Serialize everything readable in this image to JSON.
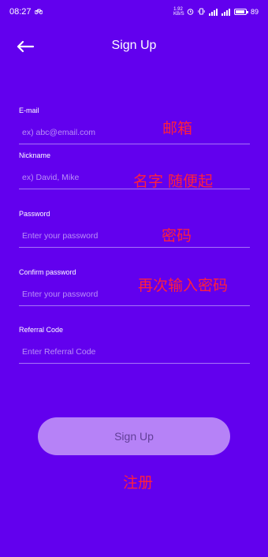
{
  "status_bar": {
    "time": "08:27",
    "speed": "1.92 KB/S",
    "battery": "89",
    "network": "4G"
  },
  "app_bar": {
    "back_icon": "arrow-left-icon",
    "title": "Sign Up"
  },
  "form": {
    "email": {
      "label": "E-mail",
      "placeholder": "ex) abc@email.com"
    },
    "nickname": {
      "label": "Nickname",
      "placeholder": "ex) David, Mike"
    },
    "password": {
      "label": "Password",
      "placeholder": "Enter your password"
    },
    "confirm_password": {
      "label": "Confirm password",
      "placeholder": "Enter your password"
    },
    "referral": {
      "label": "Referral Code",
      "placeholder": "Enter Referral Code"
    }
  },
  "submit": {
    "label": "Sign Up"
  },
  "annotations": {
    "email": "邮箱",
    "nickname": "名字 随便起",
    "password": "密码",
    "confirm_password": "再次输入密码",
    "submit": "注册"
  },
  "colors": {
    "background": "#6200EE",
    "button": "#B682F7",
    "annotation": "#FF1F3D"
  }
}
